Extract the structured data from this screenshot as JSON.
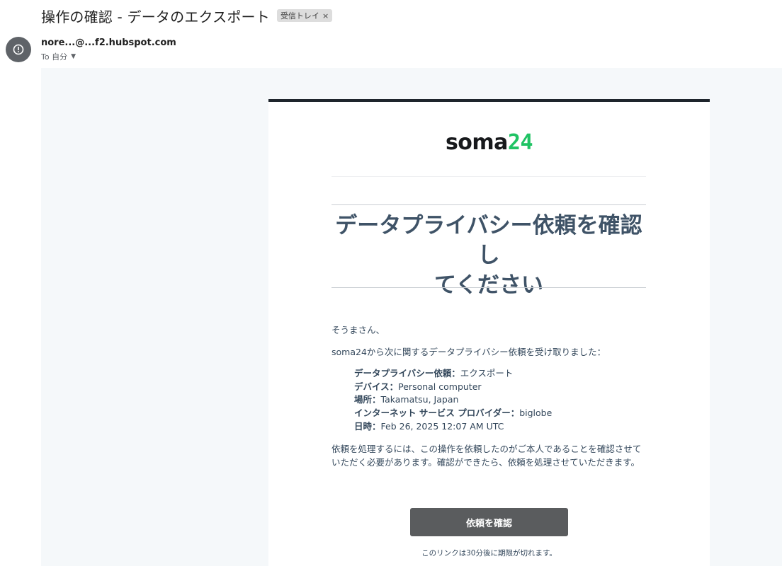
{
  "email": {
    "subject": "操作の確認 - データのエクスポート",
    "label": "受信トレイ",
    "label_close": "×",
    "sender": "nore...@...f2.hubspot.com",
    "recipient": "To 自分",
    "avatar_icon": "alert-circle-icon"
  },
  "body": {
    "logo_text": "soma",
    "logo_number": "24",
    "headline_line1": "データプライバシー依頼を確認し",
    "headline_line2": "てください",
    "greeting": "そうまさん、",
    "intro": "soma24から次に関するデータプライバシー依頼を受け取りました：",
    "details": [
      {
        "key": "データプライバシー依頼：",
        "value": "エクスポート"
      },
      {
        "key": "デバイス：",
        "value": "Personal computer"
      },
      {
        "key": "場所：",
        "value": "Takamatsu, Japan"
      },
      {
        "key": "インターネット サービス プロバイダー：",
        "value": "biglobe"
      },
      {
        "key": "日時：",
        "value": "Feb 26, 2025 12:07 AM UTC"
      }
    ],
    "explanation": "依頼を処理するには、この操作を依頼したのがご本人であることを確認させていただく必要があります。確認ができたら、依頼を処理させていただきます。",
    "button_label": "依頼を確認",
    "expiry_note": "このリンクは30分後に期限が切れます。"
  },
  "colors": {
    "headline": "#3f5367",
    "logo_accent": "#20c364",
    "button": "#5a5c5e",
    "top_bar": "#1e252c"
  }
}
